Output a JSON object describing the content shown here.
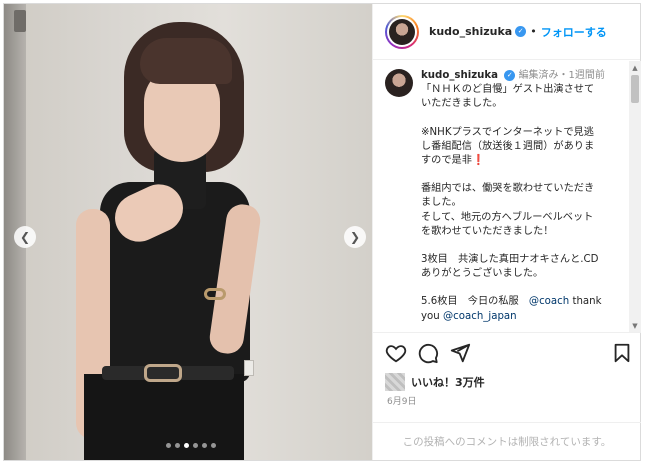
{
  "header": {
    "username": "kudo_shizuka",
    "separator": "•",
    "follow_label": "フォローする"
  },
  "caption": {
    "username": "kudo_shizuka",
    "meta": "編集済み・1週間前",
    "lines": [
      "「ＮＨＫのど自慢」ゲスト出演させて",
      "いただきました。",
      "",
      "※NHKプラスでインターネットで見逃",
      "し番組配信（放送後１週間）がありま",
      "すので是非",
      "",
      "番組内では、働哭を歌わせていただき",
      "ました。",
      "そして、地元の方へブルーベルベット",
      "を歌わせていただきました！",
      "",
      "3枚目　共演した真田ナオキさんと.CD",
      "ありがとうございました。",
      "",
      "5.6枚目　今日の私服　",
      "you "
    ],
    "exclamation": "❗",
    "mention_coach": "@coach",
    "thank": " thank",
    "mention_coach_japan": "@coach_japan"
  },
  "likes": {
    "text": "いいね！3万件"
  },
  "date": "6月9日",
  "comment_notice": "この投稿へのコメントは制限されています。",
  "carousel": {
    "total": 6,
    "active_index": 2
  },
  "icons": {
    "heart": "heart-icon",
    "comment": "comment-icon",
    "share": "share-icon",
    "save": "bookmark-icon",
    "prev": "chevron-left-icon",
    "next": "chevron-right-icon"
  }
}
